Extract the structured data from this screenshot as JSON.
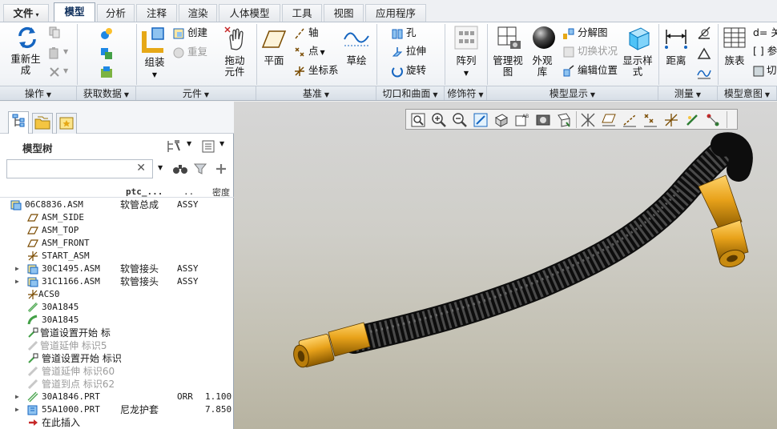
{
  "menu_tabs": [
    {
      "label": "文件",
      "caret": "▾"
    },
    {
      "label": "模型"
    },
    {
      "label": "分析"
    },
    {
      "label": "注释"
    },
    {
      "label": "渲染"
    },
    {
      "label": "人体模型"
    },
    {
      "label": "工具"
    },
    {
      "label": "视图"
    },
    {
      "label": "应用程序"
    }
  ],
  "ribbon": {
    "groups": [
      {
        "label": "操作"
      },
      {
        "label": "获取数据"
      },
      {
        "label": "元件"
      },
      {
        "label": "基准"
      },
      {
        "label": "切口和曲面"
      },
      {
        "label": "修饰符"
      },
      {
        "label": "模型显示"
      },
      {
        "label": "测量"
      },
      {
        "label": "模型意图"
      }
    ],
    "regenerate": "重新生成",
    "assemble": "组装",
    "create": "创建",
    "repeat": "重复",
    "drag_components": "拖动元件",
    "plane": "平面",
    "axis": "轴",
    "point": "点",
    "csys": "坐标系",
    "sketch": "草绘",
    "hole": "孔",
    "extrude": "拉伸",
    "revolve": "旋转",
    "pattern": "阵列",
    "manage_views": "管理视图",
    "appearance_gallery": "外观库",
    "exploded_view": "分解图",
    "toggle_status": "切换状况",
    "edit_position": "编辑位置",
    "display_style": "显示样式",
    "distance": "距离",
    "family_table": "族表",
    "relations": "d= 关",
    "parameters": "[ ] 参",
    "switch": "切"
  },
  "model_tree": {
    "title": "模型树",
    "search_value": "",
    "columns": [
      "ptc_...",
      "..",
      "密度"
    ],
    "rows": [
      {
        "name": "06C8836.ASM",
        "c1": "软管总成",
        "c2": "ASSY",
        "c3": ""
      },
      {
        "name": "ASM_SIDE",
        "c1": "",
        "c2": "",
        "c3": ""
      },
      {
        "name": "ASM_TOP",
        "c1": "",
        "c2": "",
        "c3": ""
      },
      {
        "name": "ASM_FRONT",
        "c1": "",
        "c2": "",
        "c3": ""
      },
      {
        "name": "START_ASM",
        "c1": "",
        "c2": "",
        "c3": ""
      },
      {
        "name": "30C1495.ASM",
        "c1": "软管接头",
        "c2": "ASSY",
        "c3": ""
      },
      {
        "name": "31C1166.ASM",
        "c1": "软管接头",
        "c2": "ASSY",
        "c3": ""
      },
      {
        "name": "ACS0",
        "c1": "",
        "c2": "",
        "c3": ""
      },
      {
        "name": "30A1845",
        "c1": "",
        "c2": "",
        "c3": ""
      },
      {
        "name": "30A1845",
        "c1": "",
        "c2": "",
        "c3": ""
      },
      {
        "name": "管道设置开始 标",
        "c1": "",
        "c2": "",
        "c3": ""
      },
      {
        "name": "管道延伸 标识5",
        "c1": "",
        "c2": "",
        "c3": ""
      },
      {
        "name": "管道设置开始 标识",
        "c1": "",
        "c2": "",
        "c3": ""
      },
      {
        "name": "管道延伸 标识60",
        "c1": "",
        "c2": "",
        "c3": ""
      },
      {
        "name": "管道到点 标识62",
        "c1": "",
        "c2": "",
        "c3": ""
      },
      {
        "name": "30A1846.PRT",
        "c1": "",
        "c2": "ORR",
        "c3": "1.100"
      },
      {
        "name": "55A1000.PRT",
        "c1": "尼龙护套",
        "c2": "",
        "c3": "7.850"
      },
      {
        "name": "在此插入",
        "c1": "",
        "c2": "",
        "c3": ""
      }
    ]
  },
  "colors": {
    "hose": "#1c1c1c",
    "fitting": "#e8a21a",
    "active_tab_text": "#0c2d5a"
  }
}
